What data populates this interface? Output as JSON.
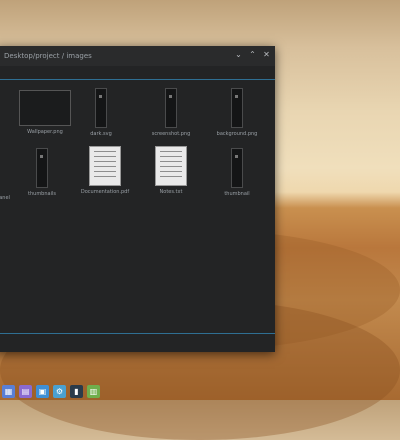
{
  "window": {
    "breadcrumb": "Desktop/project  /  images",
    "controls": {
      "minimize": "⌄",
      "maximize": "⌃",
      "close": "✕"
    }
  },
  "files": [
    {
      "name": "Wallpaper.png",
      "kind": "image-wide"
    },
    {
      "name": "dark.svg",
      "kind": "narrow"
    },
    {
      "name": "screenshot.png",
      "kind": "narrow"
    },
    {
      "name": "background.png",
      "kind": "narrow"
    },
    {
      "name": "panel",
      "kind": "edge"
    },
    {
      "name": "thumbnails",
      "kind": "narrow"
    },
    {
      "name": "Documentation.pdf",
      "kind": "doc"
    },
    {
      "name": "Notes.txt",
      "kind": "doc"
    },
    {
      "name": "thumbnail",
      "kind": "narrow"
    }
  ],
  "taskbar": [
    {
      "icon": "app-launcher-icon",
      "color": "#5a7fd6"
    },
    {
      "icon": "calendar-icon",
      "color": "#8a6ad1"
    },
    {
      "icon": "files-icon",
      "color": "#3f8fd6"
    },
    {
      "icon": "settings-icon",
      "color": "#4aa0d0"
    },
    {
      "icon": "terminal-icon",
      "color": "#2b3b4a"
    },
    {
      "icon": "notes-icon",
      "color": "#6fae4c"
    }
  ]
}
